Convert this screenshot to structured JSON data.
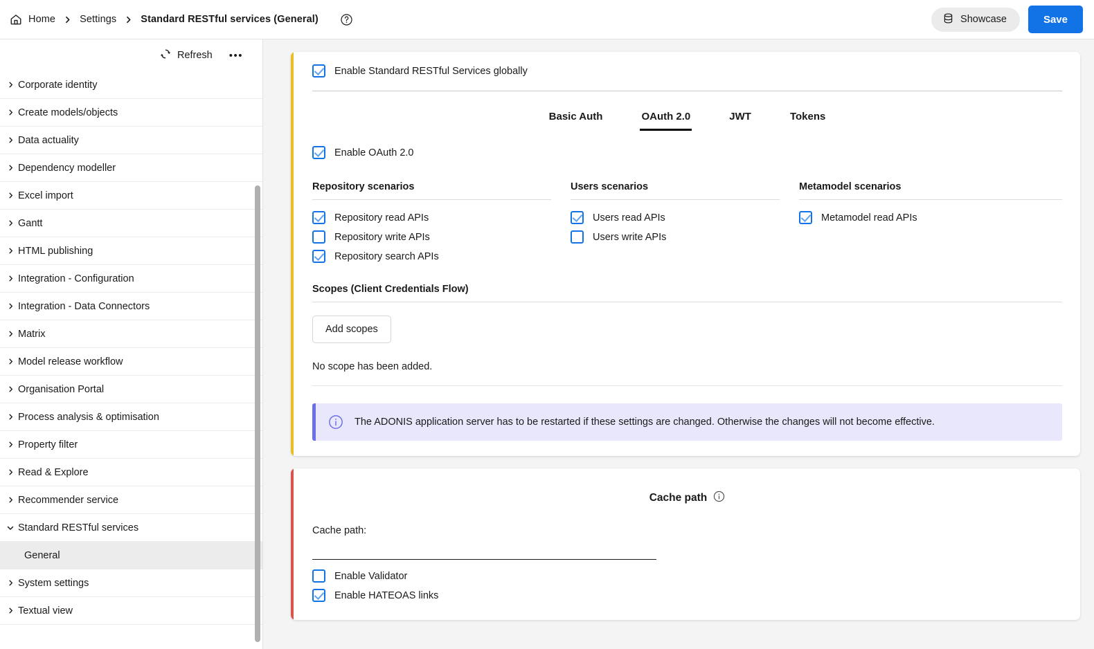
{
  "header": {
    "home_label": "Home",
    "settings_label": "Settings",
    "current_label": "Standard RESTful services (General)",
    "home_icon": "home-icon",
    "help_icon": "help-circle-icon",
    "showcase_label": "Showcase",
    "showcase_icon": "database-icon",
    "save_label": "Save",
    "accent_blue": "#1273e6"
  },
  "sidebar": {
    "refresh_label": "Refresh",
    "refresh_icon": "refresh-icon",
    "kebab_label": "•••",
    "items": [
      {
        "label": "Corporate identity"
      },
      {
        "label": "Create models/objects"
      },
      {
        "label": "Data actuality"
      },
      {
        "label": "Dependency modeller"
      },
      {
        "label": "Excel import"
      },
      {
        "label": "Gantt"
      },
      {
        "label": "HTML publishing"
      },
      {
        "label": "Integration - Configuration"
      },
      {
        "label": "Integration - Data Connectors"
      },
      {
        "label": "Matrix"
      },
      {
        "label": "Model release workflow"
      },
      {
        "label": "Organisation Portal"
      },
      {
        "label": "Process analysis & optimisation"
      },
      {
        "label": "Property filter"
      },
      {
        "label": "Read & Explore"
      },
      {
        "label": "Recommender service"
      },
      {
        "label": "Standard RESTful services"
      },
      {
        "label": "System settings"
      },
      {
        "label": "Textual view"
      }
    ],
    "expanded_item": "Standard RESTful services",
    "sub_item": {
      "label": "General",
      "active": true
    },
    "chevron_collapsed": "›",
    "chevron_expanded": "⌄"
  },
  "main": {
    "card1": {
      "accent_color": "#e8be24",
      "global_toggle": {
        "label": "Enable Standard RESTful Services globally",
        "checked": true
      },
      "tabs": [
        {
          "label": "Basic Auth",
          "active": false
        },
        {
          "label": "OAuth 2.0",
          "active": true
        },
        {
          "label": "JWT",
          "active": false
        },
        {
          "label": "Tokens",
          "active": false
        }
      ],
      "enable_oauth": {
        "label": "Enable OAuth 2.0",
        "checked": true
      },
      "scenarios": [
        {
          "title": "Repository scenarios",
          "items": [
            {
              "label": "Repository read APIs",
              "checked": true
            },
            {
              "label": "Repository write APIs",
              "checked": false
            },
            {
              "label": "Repository search APIs",
              "checked": true
            }
          ]
        },
        {
          "title": "Users scenarios",
          "items": [
            {
              "label": "Users read APIs",
              "checked": true
            },
            {
              "label": "Users write APIs",
              "checked": false
            }
          ]
        },
        {
          "title": "Metamodel scenarios",
          "items": [
            {
              "label": "Metamodel read APIs",
              "checked": true
            }
          ]
        }
      ],
      "scopes_title": "Scopes (Client Credentials Flow)",
      "add_scopes_label": "Add scopes",
      "no_scope_text": "No scope has been added.",
      "info_banner": {
        "icon": "info-circle-icon",
        "text": "The ADONIS application server has to be restarted if these settings are changed. Otherwise the changes will not become effective.",
        "background": "#e8e7fb",
        "border_color": "#6b6fe8"
      }
    },
    "card2": {
      "accent_color": "#d9534f",
      "title": "Cache path",
      "title_icon": "info-circle-icon",
      "field_label": "Cache path:",
      "field_value": "",
      "field_placeholder": "",
      "checks": [
        {
          "label": "Enable Validator",
          "checked": false
        },
        {
          "label": "Enable HATEOAS links",
          "checked": true
        }
      ]
    }
  }
}
